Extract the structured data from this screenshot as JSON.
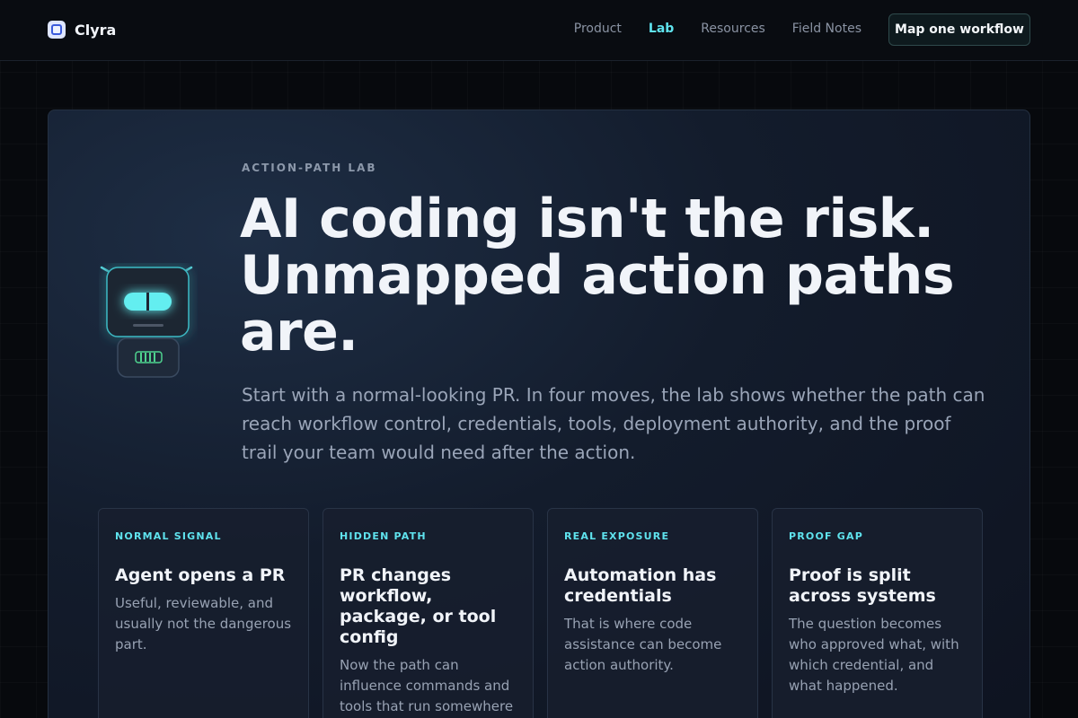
{
  "brand": {
    "name": "Clyra"
  },
  "nav": {
    "links": [
      {
        "label": "Product",
        "active": false
      },
      {
        "label": "Lab",
        "active": true
      },
      {
        "label": "Resources",
        "active": false
      },
      {
        "label": "Field Notes",
        "active": false
      }
    ],
    "cta_label": "Map one workflow"
  },
  "hero": {
    "eyebrow": "ACTION-PATH LAB",
    "headline": "AI coding isn't the risk. Unmapped action paths are.",
    "lede": "Start with a normal-looking PR. In four moves, the lab shows whether the path can reach workflow control, credentials, tools, deployment authority, and the proof trail your team would need after the action."
  },
  "cards": [
    {
      "tag": "NORMAL SIGNAL",
      "title": "Agent opens a PR",
      "body": "Useful, reviewable, and usually not the dangerous part."
    },
    {
      "tag": "HIDDEN PATH",
      "title": "PR changes workflow, package, or tool config",
      "body": "Now the path can influence commands and tools that run somewhere else."
    },
    {
      "tag": "REAL EXPOSURE",
      "title": "Automation has credentials",
      "body": "That is where code assistance can become action authority."
    },
    {
      "tag": "PROOF GAP",
      "title": "Proof is split across systems",
      "body": "The question becomes who approved what, with which credential, and what happened."
    }
  ],
  "colors": {
    "accent": "#5fe3ee",
    "background": "#07090d",
    "panel": "#131c2c"
  }
}
